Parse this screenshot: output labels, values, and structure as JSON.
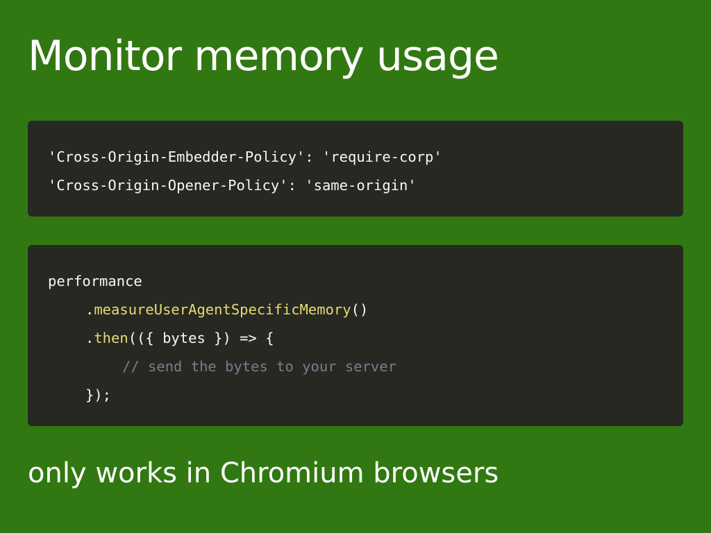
{
  "slide": {
    "title": "Monitor memory usage",
    "footer": "only works in Chromium browsers"
  },
  "headers_code": {
    "lines": [
      "'Cross-Origin-Embedder-Policy': 'require-corp'",
      "'Cross-Origin-Opener-Policy': 'same-origin'"
    ]
  },
  "js_code": {
    "line1": "performance",
    "line2_dot": ".",
    "line2_fn": "measureUserAgentSpecificMemory",
    "line2_rest": "()",
    "line3_dot": ".",
    "line3_fn": "then",
    "line3_rest": "(({ bytes }) => {",
    "line4_comment": "// send the bytes to your server",
    "line5": "});"
  },
  "colors": {
    "background": "#327812",
    "code_background": "#272822",
    "code_text": "#f8f8f2",
    "function_token": "#e6db74",
    "comment_token": "#75808c"
  }
}
